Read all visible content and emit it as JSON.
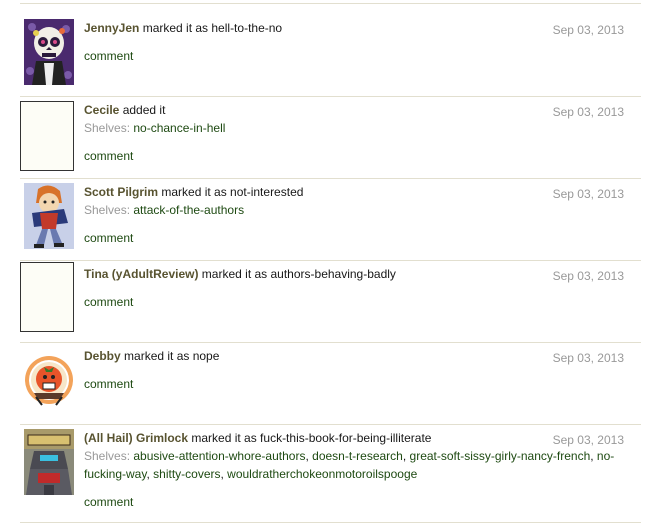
{
  "items": [
    {
      "user": "JennyJen",
      "action": " marked it as hell-to-the-no",
      "date": "Sep 03, 2013",
      "comment": "comment"
    },
    {
      "user": "Cecile",
      "action": " added it",
      "date": "Sep 03, 2013",
      "shelves_label": "Shelves: ",
      "shelves": [
        "no-chance-in-hell"
      ],
      "comment": "comment"
    },
    {
      "user": "Scott Pilgrim",
      "action": " marked it as not-interested",
      "date": "Sep 03, 2013",
      "shelves_label": "Shelves: ",
      "shelves": [
        "attack-of-the-authors"
      ],
      "comment": "comment"
    },
    {
      "user": "Tina (yAdultReview)",
      "action": " marked it as authors-behaving-badly",
      "date": "Sep 03, 2013",
      "comment": "comment"
    },
    {
      "user": "Debby",
      "action": " marked it as nope",
      "date": "Sep 03, 2013",
      "comment": "comment"
    },
    {
      "user": "(All Hail) Grimlock",
      "action": " marked it as fuck-this-book-for-being-illiterate",
      "date": "Sep 03, 2013",
      "shelves_label": "Shelves: ",
      "shelves": [
        "abusive-attention-whore-authors",
        "doesn-t-research",
        "great-soft-sissy-girly-nancy-french",
        "no-fucking-way",
        "shitty-covers",
        "wouldratherchokeonmotoroilspooge"
      ],
      "shelves_line1_suffix": "no-",
      "shelves_line2_prefix": "fucking-way",
      "comment": "comment"
    }
  ]
}
